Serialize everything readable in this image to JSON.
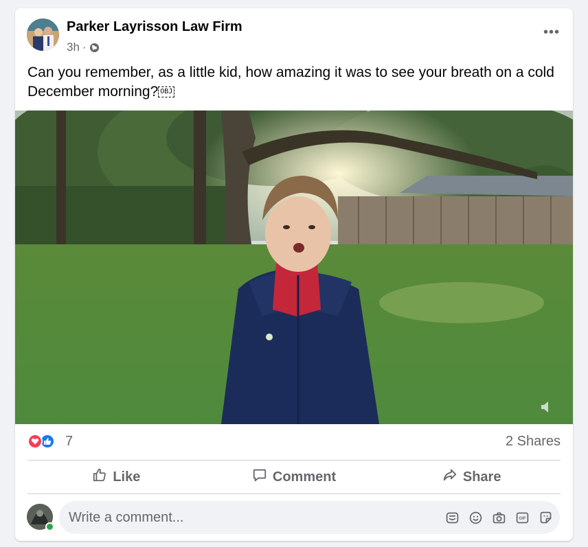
{
  "post": {
    "author": "Parker Layrisson Law Firm",
    "time": "3h",
    "separator": "·",
    "privacy_icon": "globe-icon",
    "text": "Can you remember, as a little kid, how amazing it was to see your breath on a cold December morning?",
    "text_glyph": "OBJ",
    "more_icon_glyph": "•••"
  },
  "video": {
    "volume_icon": "volume-icon"
  },
  "reactions": {
    "icons": [
      "love-icon",
      "like-icon"
    ],
    "count": "7",
    "shares": "2 Shares"
  },
  "actions": {
    "like_label": "Like",
    "comment_label": "Comment",
    "share_label": "Share"
  },
  "comment": {
    "placeholder": "Write a comment...",
    "tools": [
      "sticker-icon",
      "emoji-icon",
      "camera-icon",
      "gif-icon",
      "avatar-sticker-icon"
    ]
  },
  "colors": {
    "background": "#f0f2f5",
    "card": "#ffffff",
    "text_primary": "#050505",
    "text_secondary": "#65676b",
    "love": "#f33e58",
    "like": "#1877f2",
    "online": "#31a24c"
  }
}
